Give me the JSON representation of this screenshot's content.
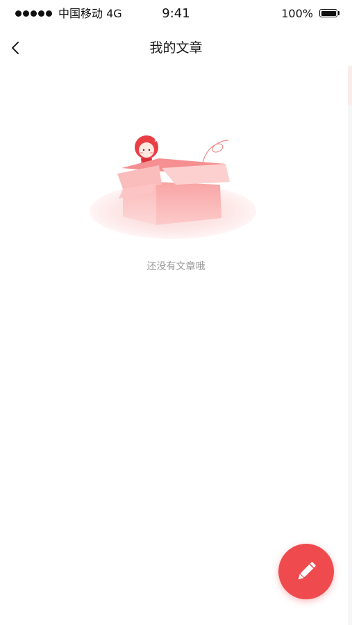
{
  "status_bar": {
    "carrier": "中国移动 4G",
    "time": "9:41",
    "battery_percent": "100%",
    "battery_level": 1.0
  },
  "nav": {
    "title": "我的文章",
    "back_icon": "chevron-left-icon"
  },
  "empty_state": {
    "illustration": "empty-box-mascot-illustration",
    "message": "还没有文章哦"
  },
  "fab": {
    "icon": "pencil-icon",
    "color": "#ef4b4f"
  },
  "colors": {
    "accent": "#ef4b4f",
    "muted_text": "#9a9a9a",
    "background": "#ffffff"
  }
}
